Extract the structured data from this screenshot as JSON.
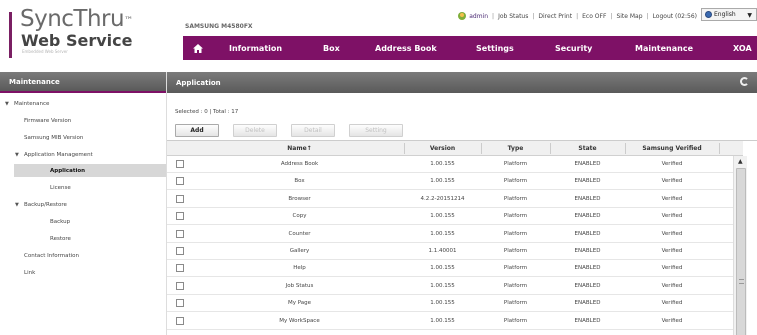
{
  "header": {
    "logo_top": "SyncThru",
    "logo_tm": "™",
    "logo_mid": "Web Service",
    "logo_sub": "Embedded Web Server",
    "model": "SAMSUNG M4580FX",
    "util": {
      "user": "admin",
      "job_status": "Job Status",
      "direct_print": "Direct Print",
      "eco": "Eco OFF",
      "site_map": "Site Map",
      "logout": "Logout (02:56)"
    },
    "language": "English"
  },
  "nav": {
    "items": [
      "Information",
      "Box",
      "Address Book",
      "Settings",
      "Security",
      "Maintenance",
      "XOA"
    ]
  },
  "sidebar": {
    "title": "Maintenance",
    "items": [
      {
        "label": "Maintenance"
      },
      {
        "label": "Firmware Version"
      },
      {
        "label": "Samsung MIB Version"
      },
      {
        "label": "Application Management"
      },
      {
        "label": "Application"
      },
      {
        "label": "License"
      },
      {
        "label": "Backup/Restore"
      },
      {
        "label": "Backup"
      },
      {
        "label": "Restore"
      },
      {
        "label": "Contact Information"
      },
      {
        "label": "Link"
      }
    ]
  },
  "main": {
    "title": "Application",
    "selection_summary": "Selected : 0 | Total : 17",
    "buttons": {
      "add": "Add",
      "delete": "Delete",
      "detail": "Detail",
      "setting": "Setting"
    },
    "columns": {
      "name": "Name↑",
      "version": "Version",
      "type": "Type",
      "state": "State",
      "verified": "Samsung Verified"
    },
    "rows": [
      {
        "name": "Address Book",
        "version": "1.00.155",
        "type": "Platform",
        "state": "ENABLED",
        "verified": "Verified"
      },
      {
        "name": "Box",
        "version": "1.00.155",
        "type": "Platform",
        "state": "ENABLED",
        "verified": "Verified"
      },
      {
        "name": "Browser",
        "version": "4.2.2-20151214",
        "type": "Platform",
        "state": "ENABLED",
        "verified": "Verified"
      },
      {
        "name": "Copy",
        "version": "1.00.155",
        "type": "Platform",
        "state": "ENABLED",
        "verified": "Verified"
      },
      {
        "name": "Counter",
        "version": "1.00.155",
        "type": "Platform",
        "state": "ENABLED",
        "verified": "Verified"
      },
      {
        "name": "Gallery",
        "version": "1.1.40001",
        "type": "Platform",
        "state": "ENABLED",
        "verified": "Verified"
      },
      {
        "name": "Help",
        "version": "1.00.155",
        "type": "Platform",
        "state": "ENABLED",
        "verified": "Verified"
      },
      {
        "name": "Job Status",
        "version": "1.00.155",
        "type": "Platform",
        "state": "ENABLED",
        "verified": "Verified"
      },
      {
        "name": "My Page",
        "version": "1.00.155",
        "type": "Platform",
        "state": "ENABLED",
        "verified": "Verified"
      },
      {
        "name": "My WorkSpace",
        "version": "1.00.155",
        "type": "Platform",
        "state": "ENABLED",
        "verified": "Verified"
      }
    ]
  },
  "colors": {
    "brand": "#7e1166",
    "panel_header": "#666666",
    "selected_nav": "#d7d7d7"
  }
}
